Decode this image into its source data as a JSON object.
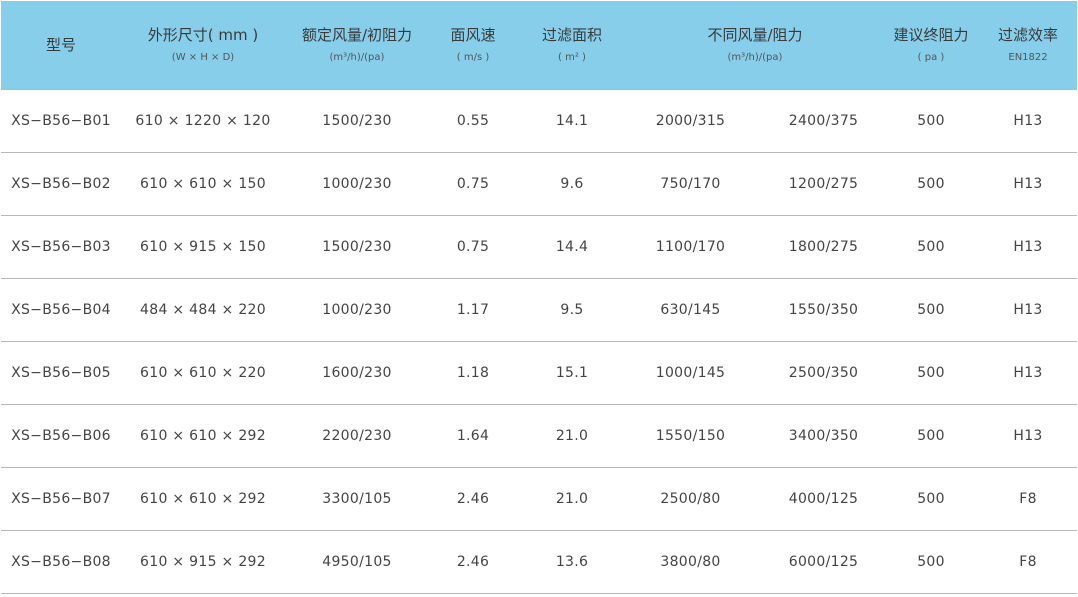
{
  "headers": {
    "model": {
      "main": "型号",
      "sub": ""
    },
    "dimensions": {
      "main": "外形尺寸( mm )",
      "sub": "(W × H × D)"
    },
    "rated_flow": {
      "main": "额定风量/初阻力",
      "sub": "(m³/h)/(pa)"
    },
    "face_velocity": {
      "main": "面风速",
      "sub": "( m/s )"
    },
    "filter_area": {
      "main": "过滤面积",
      "sub": "( m² )"
    },
    "flow_resistance": {
      "main": "不同风量/阻力",
      "sub": "(m³/h)/(pa)"
    },
    "final_resistance": {
      "main": "建议终阻力",
      "sub": "( pa )"
    },
    "efficiency": {
      "main": "过滤效率",
      "sub": "EN1822"
    }
  },
  "rows": [
    {
      "model": "XS−B56−B01",
      "dimensions": "610 × 1220 × 120",
      "rated_flow": "1500/230",
      "face_velocity": "0.55",
      "filter_area": "14.1",
      "flow_a": "2000/315",
      "flow_b": "2400/375",
      "final_resistance": "500",
      "efficiency": "H13"
    },
    {
      "model": "XS−B56−B02",
      "dimensions": "610 × 610 × 150",
      "rated_flow": "1000/230",
      "face_velocity": "0.75",
      "filter_area": "9.6",
      "flow_a": "750/170",
      "flow_b": "1200/275",
      "final_resistance": "500",
      "efficiency": "H13"
    },
    {
      "model": "XS−B56−B03",
      "dimensions": "610 × 915 × 150",
      "rated_flow": "1500/230",
      "face_velocity": "0.75",
      "filter_area": "14.4",
      "flow_a": "1100/170",
      "flow_b": "1800/275",
      "final_resistance": "500",
      "efficiency": "H13"
    },
    {
      "model": "XS−B56−B04",
      "dimensions": "484 × 484 × 220",
      "rated_flow": "1000/230",
      "face_velocity": "1.17",
      "filter_area": "9.5",
      "flow_a": "630/145",
      "flow_b": "1550/350",
      "final_resistance": "500",
      "efficiency": "H13"
    },
    {
      "model": "XS−B56−B05",
      "dimensions": "610 × 610 × 220",
      "rated_flow": "1600/230",
      "face_velocity": "1.18",
      "filter_area": "15.1",
      "flow_a": "1000/145",
      "flow_b": "2500/350",
      "final_resistance": "500",
      "efficiency": "H13"
    },
    {
      "model": "XS−B56−B06",
      "dimensions": "610 × 610 × 292",
      "rated_flow": "2200/230",
      "face_velocity": "1.64",
      "filter_area": "21.0",
      "flow_a": "1550/150",
      "flow_b": "3400/350",
      "final_resistance": "500",
      "efficiency": "H13"
    },
    {
      "model": "XS−B56−B07",
      "dimensions": "610 × 610 × 292",
      "rated_flow": "3300/105",
      "face_velocity": "2.46",
      "filter_area": "21.0",
      "flow_a": "2500/80",
      "flow_b": "4000/125",
      "final_resistance": "500",
      "efficiency": "F8"
    },
    {
      "model": "XS−B56−B08",
      "dimensions": "610 × 915 × 292",
      "rated_flow": "4950/105",
      "face_velocity": "2.46",
      "filter_area": "13.6",
      "flow_a": "3800/80",
      "flow_b": "6000/125",
      "final_resistance": "500",
      "efficiency": "F8"
    }
  ],
  "colors": {
    "header_bg": "#87ceeb",
    "row_divider": "#b8b8b8",
    "text": "#444444"
  }
}
